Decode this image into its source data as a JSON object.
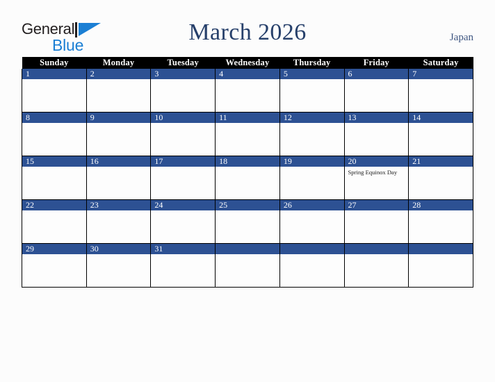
{
  "brand": {
    "name_part1": "General",
    "name_part2": "Blue",
    "mark_icon": "triangle-icon",
    "color_dark": "#231f20",
    "color_blue": "#1b7fd4"
  },
  "header": {
    "title": "March 2026",
    "country": "Japan",
    "title_color": "#27406b"
  },
  "calendar": {
    "month": "March",
    "year": "2026",
    "accent_color": "#2d5193",
    "header_bg": "#000000",
    "weekday_headers": [
      "Sunday",
      "Monday",
      "Tuesday",
      "Wednesday",
      "Thursday",
      "Friday",
      "Saturday"
    ],
    "weeks": [
      [
        {
          "day": "1",
          "events": []
        },
        {
          "day": "2",
          "events": []
        },
        {
          "day": "3",
          "events": []
        },
        {
          "day": "4",
          "events": []
        },
        {
          "day": "5",
          "events": []
        },
        {
          "day": "6",
          "events": []
        },
        {
          "day": "7",
          "events": []
        }
      ],
      [
        {
          "day": "8",
          "events": []
        },
        {
          "day": "9",
          "events": []
        },
        {
          "day": "10",
          "events": []
        },
        {
          "day": "11",
          "events": []
        },
        {
          "day": "12",
          "events": []
        },
        {
          "day": "13",
          "events": []
        },
        {
          "day": "14",
          "events": []
        }
      ],
      [
        {
          "day": "15",
          "events": []
        },
        {
          "day": "16",
          "events": []
        },
        {
          "day": "17",
          "events": []
        },
        {
          "day": "18",
          "events": []
        },
        {
          "day": "19",
          "events": []
        },
        {
          "day": "20",
          "events": [
            "Spring Equinox Day"
          ]
        },
        {
          "day": "21",
          "events": []
        }
      ],
      [
        {
          "day": "22",
          "events": []
        },
        {
          "day": "23",
          "events": []
        },
        {
          "day": "24",
          "events": []
        },
        {
          "day": "25",
          "events": []
        },
        {
          "day": "26",
          "events": []
        },
        {
          "day": "27",
          "events": []
        },
        {
          "day": "28",
          "events": []
        }
      ],
      [
        {
          "day": "29",
          "events": []
        },
        {
          "day": "30",
          "events": []
        },
        {
          "day": "31",
          "events": []
        },
        {
          "day": "",
          "events": []
        },
        {
          "day": "",
          "events": []
        },
        {
          "day": "",
          "events": []
        },
        {
          "day": "",
          "events": []
        }
      ]
    ]
  }
}
